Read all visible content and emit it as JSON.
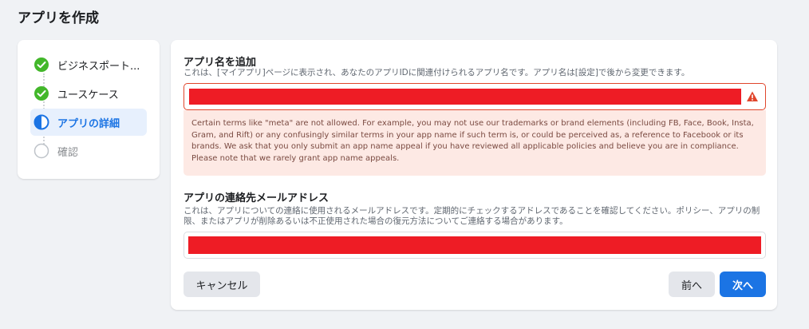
{
  "page": {
    "title": "アプリを作成"
  },
  "stepper": {
    "steps": [
      {
        "label": "ビジネスポート...",
        "state": "done"
      },
      {
        "label": "ユースケース",
        "state": "done"
      },
      {
        "label": "アプリの詳細",
        "state": "active"
      },
      {
        "label": "確認",
        "state": "pending"
      }
    ]
  },
  "form": {
    "app_name": {
      "label": "アプリ名を追加",
      "description": "これは、[マイアプリ]ページに表示され、あなたのアプリIDに関連付けられるアプリ名です。アプリ名は[設定]で後から変更できます。",
      "error": "Certain terms like \"meta\" are not allowed. For example, you may not use our trademarks or brand elements (including FB, Face, Book, Insta, Gram, and Rift) or any confusingly similar terms in your app name if such term is, or could be perceived as, a reference to Facebook or its brands. We ask that you only submit an app name appeal if you have reviewed all applicable policies and believe you are in compliance. Please note that we rarely grant app name appeals."
    },
    "email": {
      "label": "アプリの連絡先メールアドレス",
      "description": "これは、アプリについての連絡に使用されるメールアドレスです。定期的にチェックするアドレスであることを確認してください。ポリシー、アプリの制限、またはアプリが削除あるいは不正使用された場合の復元方法についてご連絡する場合があります。"
    }
  },
  "buttons": {
    "cancel": "キャンセル",
    "back": "前へ",
    "next": "次へ"
  },
  "colors": {
    "accent": "#1b74e4",
    "done": "#42b72a",
    "error": "#e0452b",
    "redaction": "#ee1c25"
  }
}
